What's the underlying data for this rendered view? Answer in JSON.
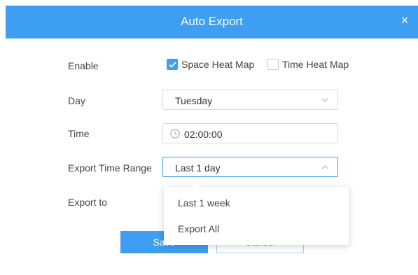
{
  "dialog": {
    "title": "Auto Export",
    "close_glyph": "×"
  },
  "form": {
    "enable_label": "Enable",
    "space_heat_map": {
      "label": "Space Heat Map",
      "checked": true
    },
    "time_heat_map": {
      "label": "Time Heat Map",
      "checked": false
    },
    "day_label": "Day",
    "day_value": "Tuesday",
    "time_label": "Time",
    "time_value": "02:00:00",
    "range_label": "Export Time Range",
    "range_value": "Last 1 day",
    "export_to_label": "Export to"
  },
  "dropdown": {
    "options": [
      "Last 1 week",
      "Export All"
    ]
  },
  "buttons": {
    "save": "Save",
    "cancel": "Cancel"
  },
  "icons": {
    "close": "close-icon",
    "check": "checkmark-icon",
    "chevron_down": "chevron-down-icon",
    "chevron_up": "chevron-up-icon",
    "clock": "clock-icon"
  },
  "colors": {
    "accent": "#3e9ef2",
    "border": "#d7dbe1"
  }
}
